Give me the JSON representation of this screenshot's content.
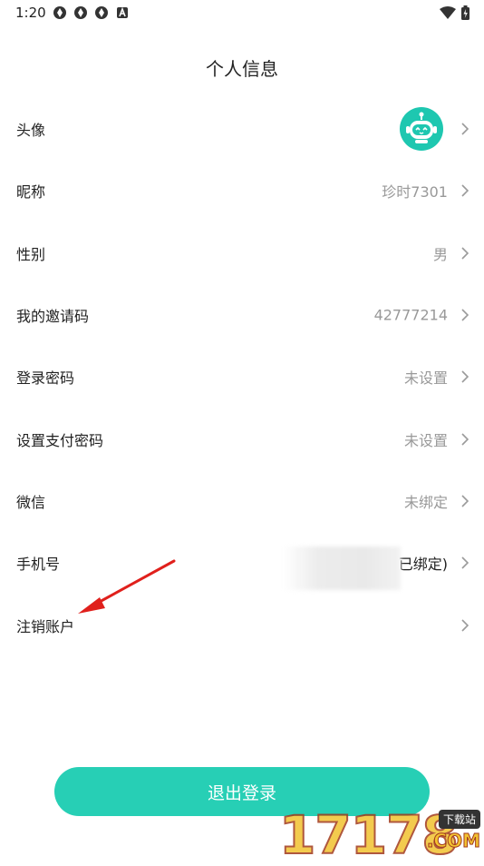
{
  "status_bar": {
    "time": "1:20",
    "icons": [
      "app-notification-icon",
      "app-notification-icon",
      "app-notification-icon",
      "a-notification-icon"
    ],
    "right_icons": [
      "wifi-icon",
      "battery-icon"
    ]
  },
  "header": {
    "title": "个人信息"
  },
  "rows": [
    {
      "label": "头像",
      "value": "",
      "type": "avatar",
      "icon": "robot-avatar-icon"
    },
    {
      "label": "昵称",
      "value": "珍时7301"
    },
    {
      "label": "性别",
      "value": "男"
    },
    {
      "label": "我的邀请码",
      "value": "42777214"
    },
    {
      "label": "登录密码",
      "value": "未设置"
    },
    {
      "label": "设置支付密码",
      "value": "未设置"
    },
    {
      "label": "微信",
      "value": "未绑定"
    },
    {
      "label": "手机号",
      "value": "已绑定)"
    },
    {
      "label": "注销账户",
      "value": ""
    }
  ],
  "footer": {
    "logout_label": "退出登录"
  },
  "colors": {
    "accent": "#27cfb5",
    "avatar_bg": "#1ec7b0",
    "annotation": "#e0201c"
  },
  "watermark": {
    "digits": "17178",
    "tag": "下载站",
    "suffix": ".COM"
  }
}
